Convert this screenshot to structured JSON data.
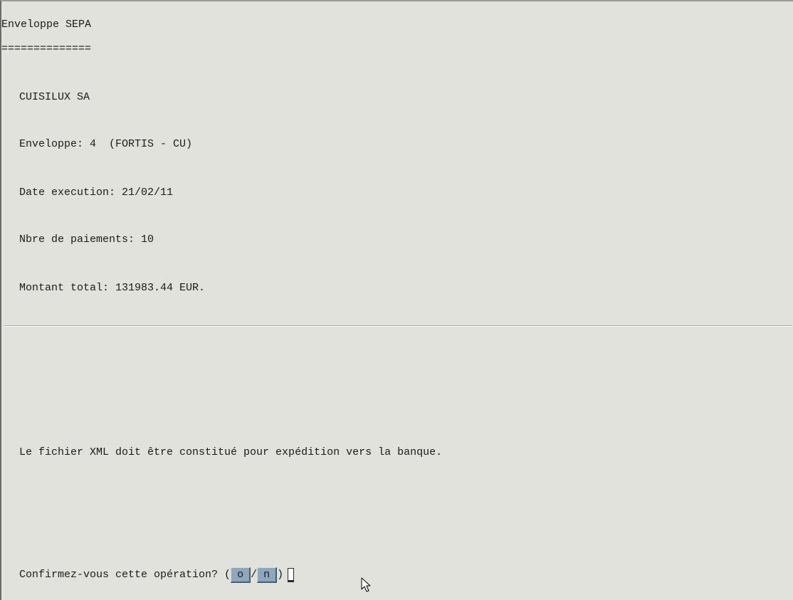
{
  "header": {
    "title": "Enveloppe SEPA",
    "underline": "=============="
  },
  "details": {
    "company": "CUISILUX SA",
    "envelope": "Enveloppe: 4  (FORTIS - CU)",
    "execution_date": "Date execution: 21/02/11",
    "payment_count": "Nbre de paiements: 10",
    "total_amount": "Montant total: 131983.44 EUR."
  },
  "message": "Le fichier XML doit être constitué pour expédition vers la banque.",
  "confirm": {
    "question": "Confirmez-vous cette opération? (",
    "yes_label": "o",
    "separator": "/",
    "no_label": "n",
    "close_paren": ")"
  }
}
